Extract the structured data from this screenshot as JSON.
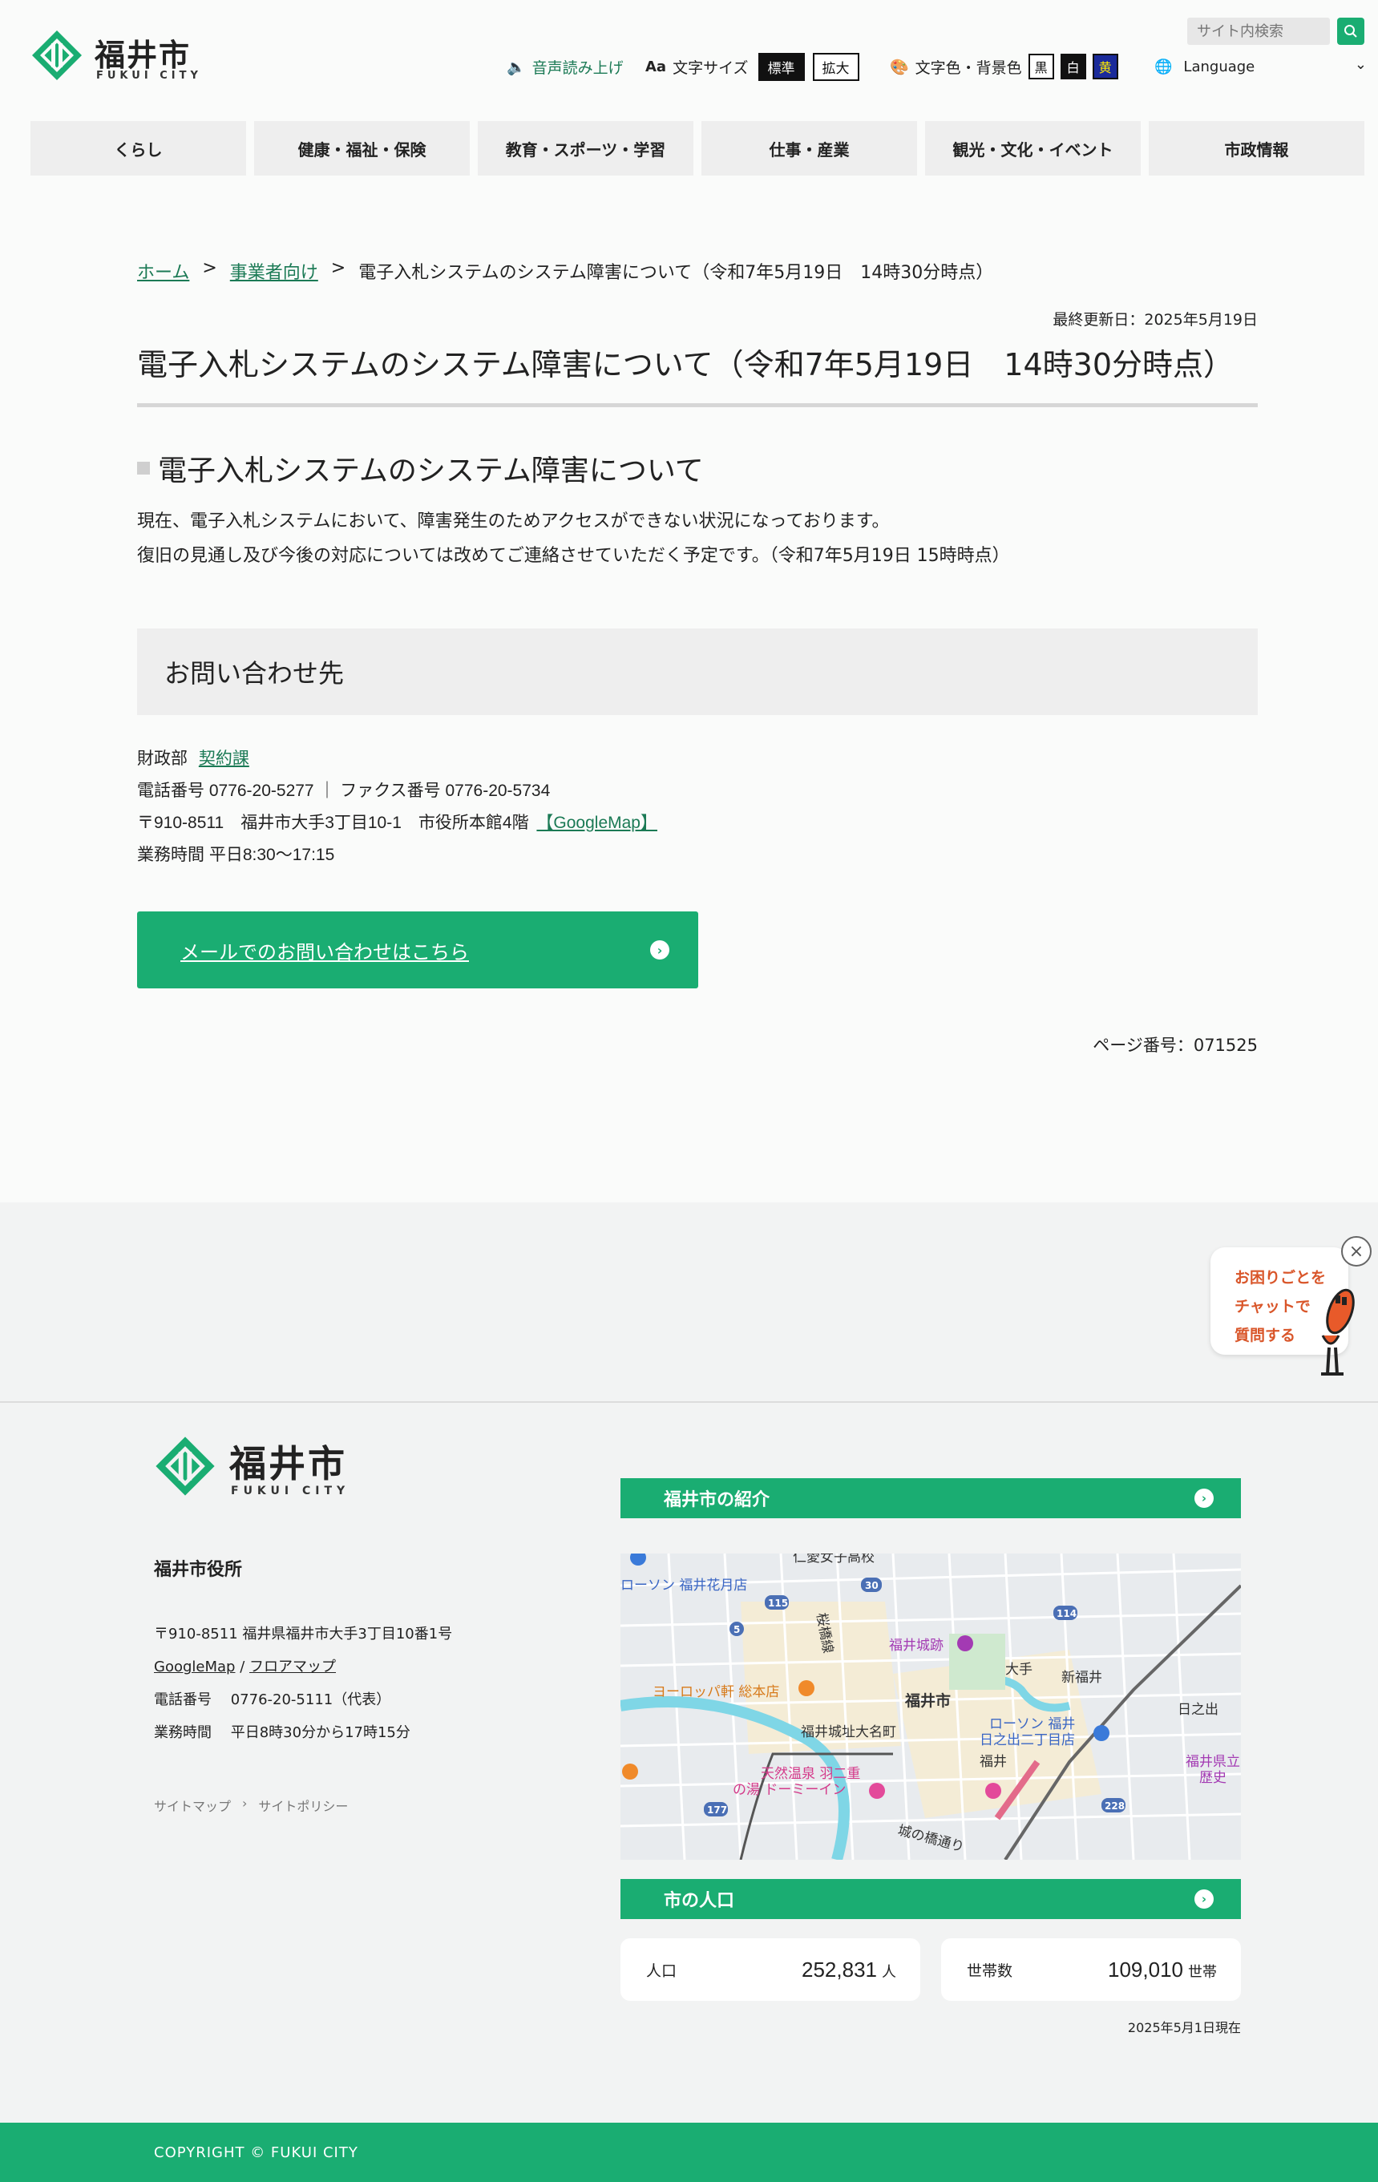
{
  "header": {
    "logo_name": "福井市",
    "logo_sub": "FUKUI CITY",
    "voice_label": "音声読み上げ",
    "fontsize_label": "文字サイズ",
    "fontsize_standard": "標準",
    "fontsize_large": "拡大",
    "color_label": "文字色・背景色",
    "color_black": "黒",
    "color_white": "白",
    "color_yellow": "黄",
    "language_label": "Language",
    "search_placeholder": "サイト内検索"
  },
  "nav": [
    "くらし",
    "健康・福祉・保険",
    "教育・スポーツ・学習",
    "仕事・産業",
    "観光・文化・イベント",
    "市政情報"
  ],
  "breadcrumb": {
    "home": "ホーム",
    "sep": ">",
    "business": "事業者向け",
    "current": "電子入札システムのシステム障害について（令和7年5月19日　14時30分時点）"
  },
  "main": {
    "updated": "最終更新日：2025年5月19日",
    "title": "電子入札システムのシステム障害について（令和7年5月19日　14時30分時点）",
    "h2": "電子入札システムのシステム障害について",
    "p1": "現在、電子入札システムにおいて、障害発生のためアクセスができない状況になっております。",
    "p2": "復旧の見通し及び今後の対応については改めてご連絡させていただく予定です。（令和7年5月19日 15時時点）",
    "contact_heading": "お問い合わせ先",
    "dept": "財政部",
    "section_link": "契約課",
    "phone_fax": "電話番号  0776-20-5277  ｜  ファクス番号  0776-20-5734",
    "address": "〒910-8511　福井市大手3丁目10-1　市役所本館4階",
    "map_link": "【GoogleMap】",
    "hours": "業務時間  平日8:30～17:15",
    "mail_button": "メールでのお問い合わせはこちら",
    "page_no": "ページ番号：071525"
  },
  "chat": {
    "line1": "お困りごとを",
    "line2": "チャットで",
    "line3": "質問する"
  },
  "footer": {
    "logo_name": "福井市",
    "logo_sub": "FUKUI CITY",
    "office_name": "福井市役所",
    "address": "〒910-8511 福井県福井市大手3丁目10番1号",
    "googlemap": "GoogleMap",
    "slash": "/",
    "floormap": "フロアマップ",
    "phone": "電話番号　 0776-20-5111（代表）",
    "hours": "業務時間　 平日8時30分から17時15分",
    "sitemap": "サイトマップ",
    "link_sep": "›",
    "policy": "サイトポリシー",
    "intro_bar": "福井市の紹介",
    "population_bar": "市の人口",
    "pop_label": "人口",
    "pop_value": "252,831",
    "pop_unit": "人",
    "hh_label": "世帯数",
    "hh_value": "109,010",
    "hh_unit": "世帯",
    "as_of": "2025年5月1日現在",
    "copyright": "COPYRIGHT © FUKUI CITY"
  },
  "map": {
    "labels": [
      "仁愛女子高校",
      "ローソン 福井花月店",
      "福井城跡",
      "大手",
      "新福井",
      "福井市",
      "ヨーロッパ軒 総本店",
      "福井城址大名町",
      "ローソン 福井",
      "日之出二丁目店",
      "日之出",
      "福井",
      "天然温泉 羽二重",
      "の湯 ドーミーイン",
      "城の橋通り",
      "桜橋線",
      "福井県立",
      "歴史"
    ],
    "route_numbers": [
      "30",
      "115",
      "114",
      "5",
      "177",
      "228"
    ]
  },
  "colors": {
    "accent": "#1aad72",
    "link": "#1b7a55",
    "chat_text": "#d9562a"
  }
}
